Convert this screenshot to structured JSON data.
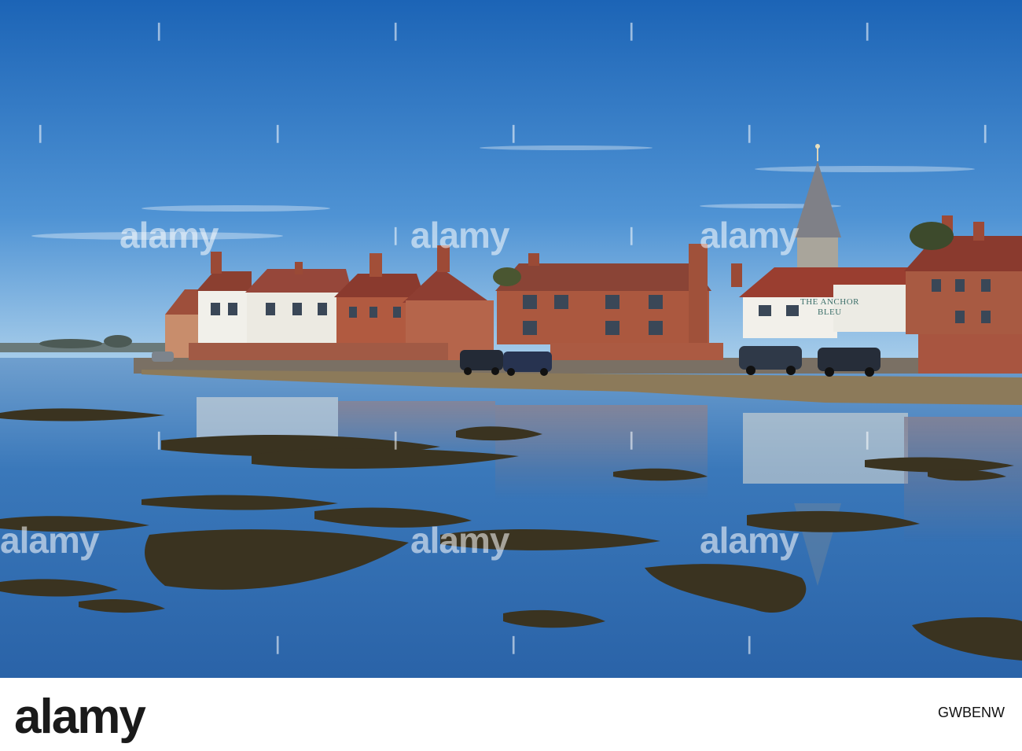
{
  "watermark": {
    "brand": "alamy",
    "tick_glyph": "❘"
  },
  "signage": {
    "pub_sign_line1": "THE ANCHOR",
    "pub_sign_line2": "BLEU"
  },
  "footer": {
    "logo": "alamy",
    "image_id": "GWBENW",
    "caption": "",
    "site": ""
  },
  "colors": {
    "sky_top": "#1f68b8",
    "sky_bottom": "#8fbfe6",
    "water": "#2f6db0",
    "brick": "#a5553e",
    "white_house": "#f1f0ea",
    "seaweed": "#3a3320"
  }
}
